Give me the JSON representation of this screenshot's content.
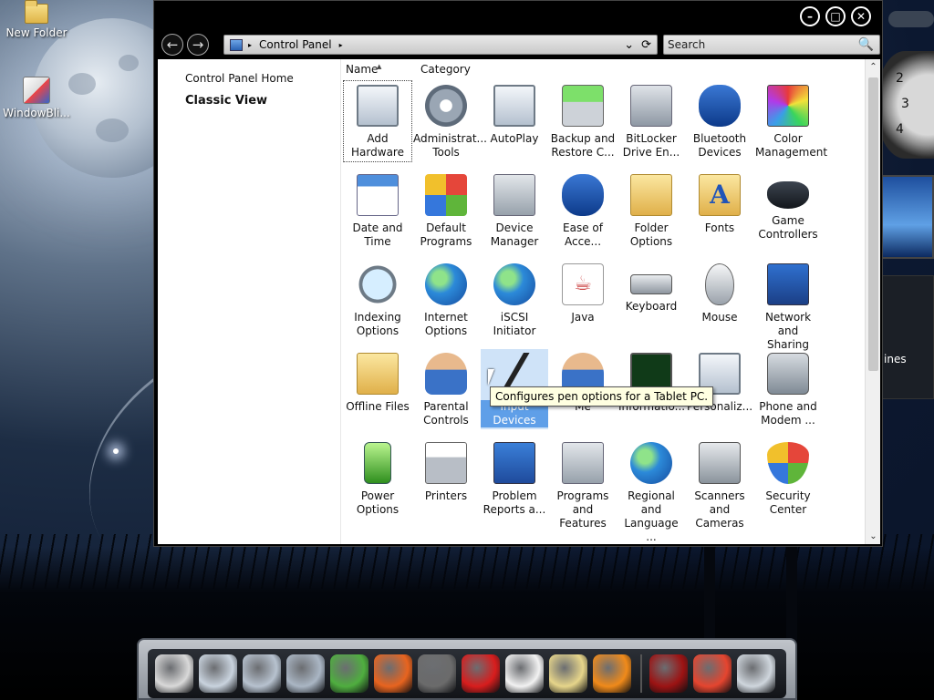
{
  "desktop": {
    "icons": [
      {
        "label": "New Folder",
        "icon": "folder-icon"
      },
      {
        "label": "WindowBli...",
        "icon": "windowblinds-icon"
      }
    ]
  },
  "window": {
    "controls": {
      "minimize": "–",
      "maximize": "□",
      "close": "✕"
    },
    "nav": {
      "back": "←",
      "forward": "→"
    },
    "address": {
      "path": "Control Panel",
      "path_arrow": "▸",
      "dropdown": "⌄",
      "refresh": "⟳"
    },
    "search": {
      "placeholder": "Search",
      "icon": "🔍"
    },
    "left_pane": {
      "home": "Control Panel Home",
      "classic": "Classic View"
    },
    "columns": {
      "name": "Name",
      "category": "Category"
    },
    "items": [
      {
        "l1": "Add",
        "l2": "Hardware",
        "icon": "add-hardware-icon",
        "look": "i-monitor"
      },
      {
        "l1": "Administrat...",
        "l2": "Tools",
        "icon": "administrative-tools-icon",
        "look": "i-gears"
      },
      {
        "l1": "AutoPlay",
        "l2": "",
        "icon": "autoplay-icon",
        "look": "i-monitor"
      },
      {
        "l1": "Backup and",
        "l2": "Restore C...",
        "icon": "backup-restore-icon",
        "look": "i-backup"
      },
      {
        "l1": "BitLocker",
        "l2": "Drive En...",
        "icon": "bitlocker-icon",
        "look": "i-drive"
      },
      {
        "l1": "Bluetooth",
        "l2": "Devices",
        "icon": "bluetooth-icon",
        "look": "i-bt"
      },
      {
        "l1": "Color",
        "l2": "Management",
        "icon": "color-management-icon",
        "look": "i-color"
      },
      {
        "l1": "Date and",
        "l2": "Time",
        "icon": "date-time-icon",
        "look": "i-calendar"
      },
      {
        "l1": "Default",
        "l2": "Programs",
        "icon": "default-programs-icon",
        "look": "i-flag"
      },
      {
        "l1": "Device",
        "l2": "Manager",
        "icon": "device-manager-icon",
        "look": "i-box"
      },
      {
        "l1": "Ease of",
        "l2": "Acce...",
        "icon": "ease-of-access-icon",
        "look": "i-bt"
      },
      {
        "l1": "Folder",
        "l2": "Options",
        "icon": "folder-options-icon",
        "look": "i-folder"
      },
      {
        "l1": "Fonts",
        "l2": "",
        "icon": "fonts-icon",
        "look": "i-fonts"
      },
      {
        "l1": "Game",
        "l2": "Controllers",
        "icon": "game-controllers-icon",
        "look": "i-gamepad"
      },
      {
        "l1": "Indexing",
        "l2": "Options",
        "icon": "indexing-options-icon",
        "look": "i-magnify"
      },
      {
        "l1": "Internet",
        "l2": "Options",
        "icon": "internet-options-icon",
        "look": "i-globe"
      },
      {
        "l1": "iSCSI Initiator",
        "l2": "",
        "icon": "iscsi-icon",
        "look": "i-globe"
      },
      {
        "l1": "Java",
        "l2": "",
        "icon": "java-icon",
        "look": "i-java"
      },
      {
        "l1": "Keyboard",
        "l2": "",
        "icon": "keyboard-icon",
        "look": "i-kbd"
      },
      {
        "l1": "Mouse",
        "l2": "",
        "icon": "mouse-icon",
        "look": "i-mouse"
      },
      {
        "l1": "Network and",
        "l2": "Sharing Ce...",
        "icon": "network-icon",
        "look": "i-network"
      },
      {
        "l1": "Offline Files",
        "l2": "",
        "icon": "offline-files-icon",
        "look": "i-folder"
      },
      {
        "l1": "Parental",
        "l2": "Controls",
        "icon": "parental-controls-icon",
        "look": "i-person"
      },
      {
        "l1": "Input Devices",
        "l2": "",
        "icon": "pen-input-icon",
        "look": "i-pen"
      },
      {
        "l1": "Me",
        "l2": "",
        "icon": "people-near-me-icon",
        "look": "i-person"
      },
      {
        "l1": "Informatio...",
        "l2": "",
        "icon": "performance-icon",
        "look": "i-pulse"
      },
      {
        "l1": "Personaliz...",
        "l2": "",
        "icon": "personalization-icon",
        "look": "i-monitor"
      },
      {
        "l1": "Phone and",
        "l2": "Modem ...",
        "icon": "phone-modem-icon",
        "look": "i-phone"
      },
      {
        "l1": "Power",
        "l2": "Options",
        "icon": "power-options-icon",
        "look": "i-power"
      },
      {
        "l1": "Printers",
        "l2": "",
        "icon": "printers-icon",
        "look": "i-printer"
      },
      {
        "l1": "Problem",
        "l2": "Reports a...",
        "icon": "problem-reports-icon",
        "look": "i-warning"
      },
      {
        "l1": "Programs",
        "l2": "and Features",
        "icon": "programs-features-icon",
        "look": "i-box"
      },
      {
        "l1": "Regional and",
        "l2": "Language ...",
        "icon": "regional-language-icon",
        "look": "i-globe"
      },
      {
        "l1": "Scanners and",
        "l2": "Cameras",
        "icon": "scanners-cameras-icon",
        "look": "i-camera"
      },
      {
        "l1": "Security",
        "l2": "Center",
        "icon": "security-center-icon",
        "look": "i-shield"
      }
    ],
    "tooltip": "Configures pen options for a Tablet PC.",
    "scroll": {
      "up": "⌃",
      "down": "⌄"
    }
  },
  "gadgets": {
    "clock_numbers": [
      "2",
      "3",
      "4"
    ],
    "news_text": "ines"
  },
  "dock": {
    "items": [
      {
        "icon": "presentation-icon",
        "color": "#d9d9d9"
      },
      {
        "icon": "documents-folder-icon",
        "color": "#c9d3de"
      },
      {
        "icon": "pictures-folder-icon",
        "color": "#b7c2cf"
      },
      {
        "icon": "folder-icon",
        "color": "#aab6c4"
      },
      {
        "icon": "messenger-icon",
        "color": "#4fae3f"
      },
      {
        "icon": "firefox-icon",
        "color": "#e8641f"
      },
      {
        "icon": "raccoon-icon",
        "color": "#6b6b6b"
      },
      {
        "icon": "opera-icon",
        "color": "#d81d1d"
      },
      {
        "icon": "yandex-icon",
        "color": "#f2f2f2"
      },
      {
        "icon": "notepad-icon",
        "color": "#e6d58a"
      },
      {
        "icon": "vlc-icon",
        "color": "#f08a1a"
      },
      {
        "icon": "flash-icon",
        "color": "#9c1313"
      },
      {
        "icon": "p-app-icon",
        "color": "#e5452f"
      },
      {
        "icon": "recycle-bin-icon",
        "color": "#cfd6dd"
      }
    ]
  }
}
